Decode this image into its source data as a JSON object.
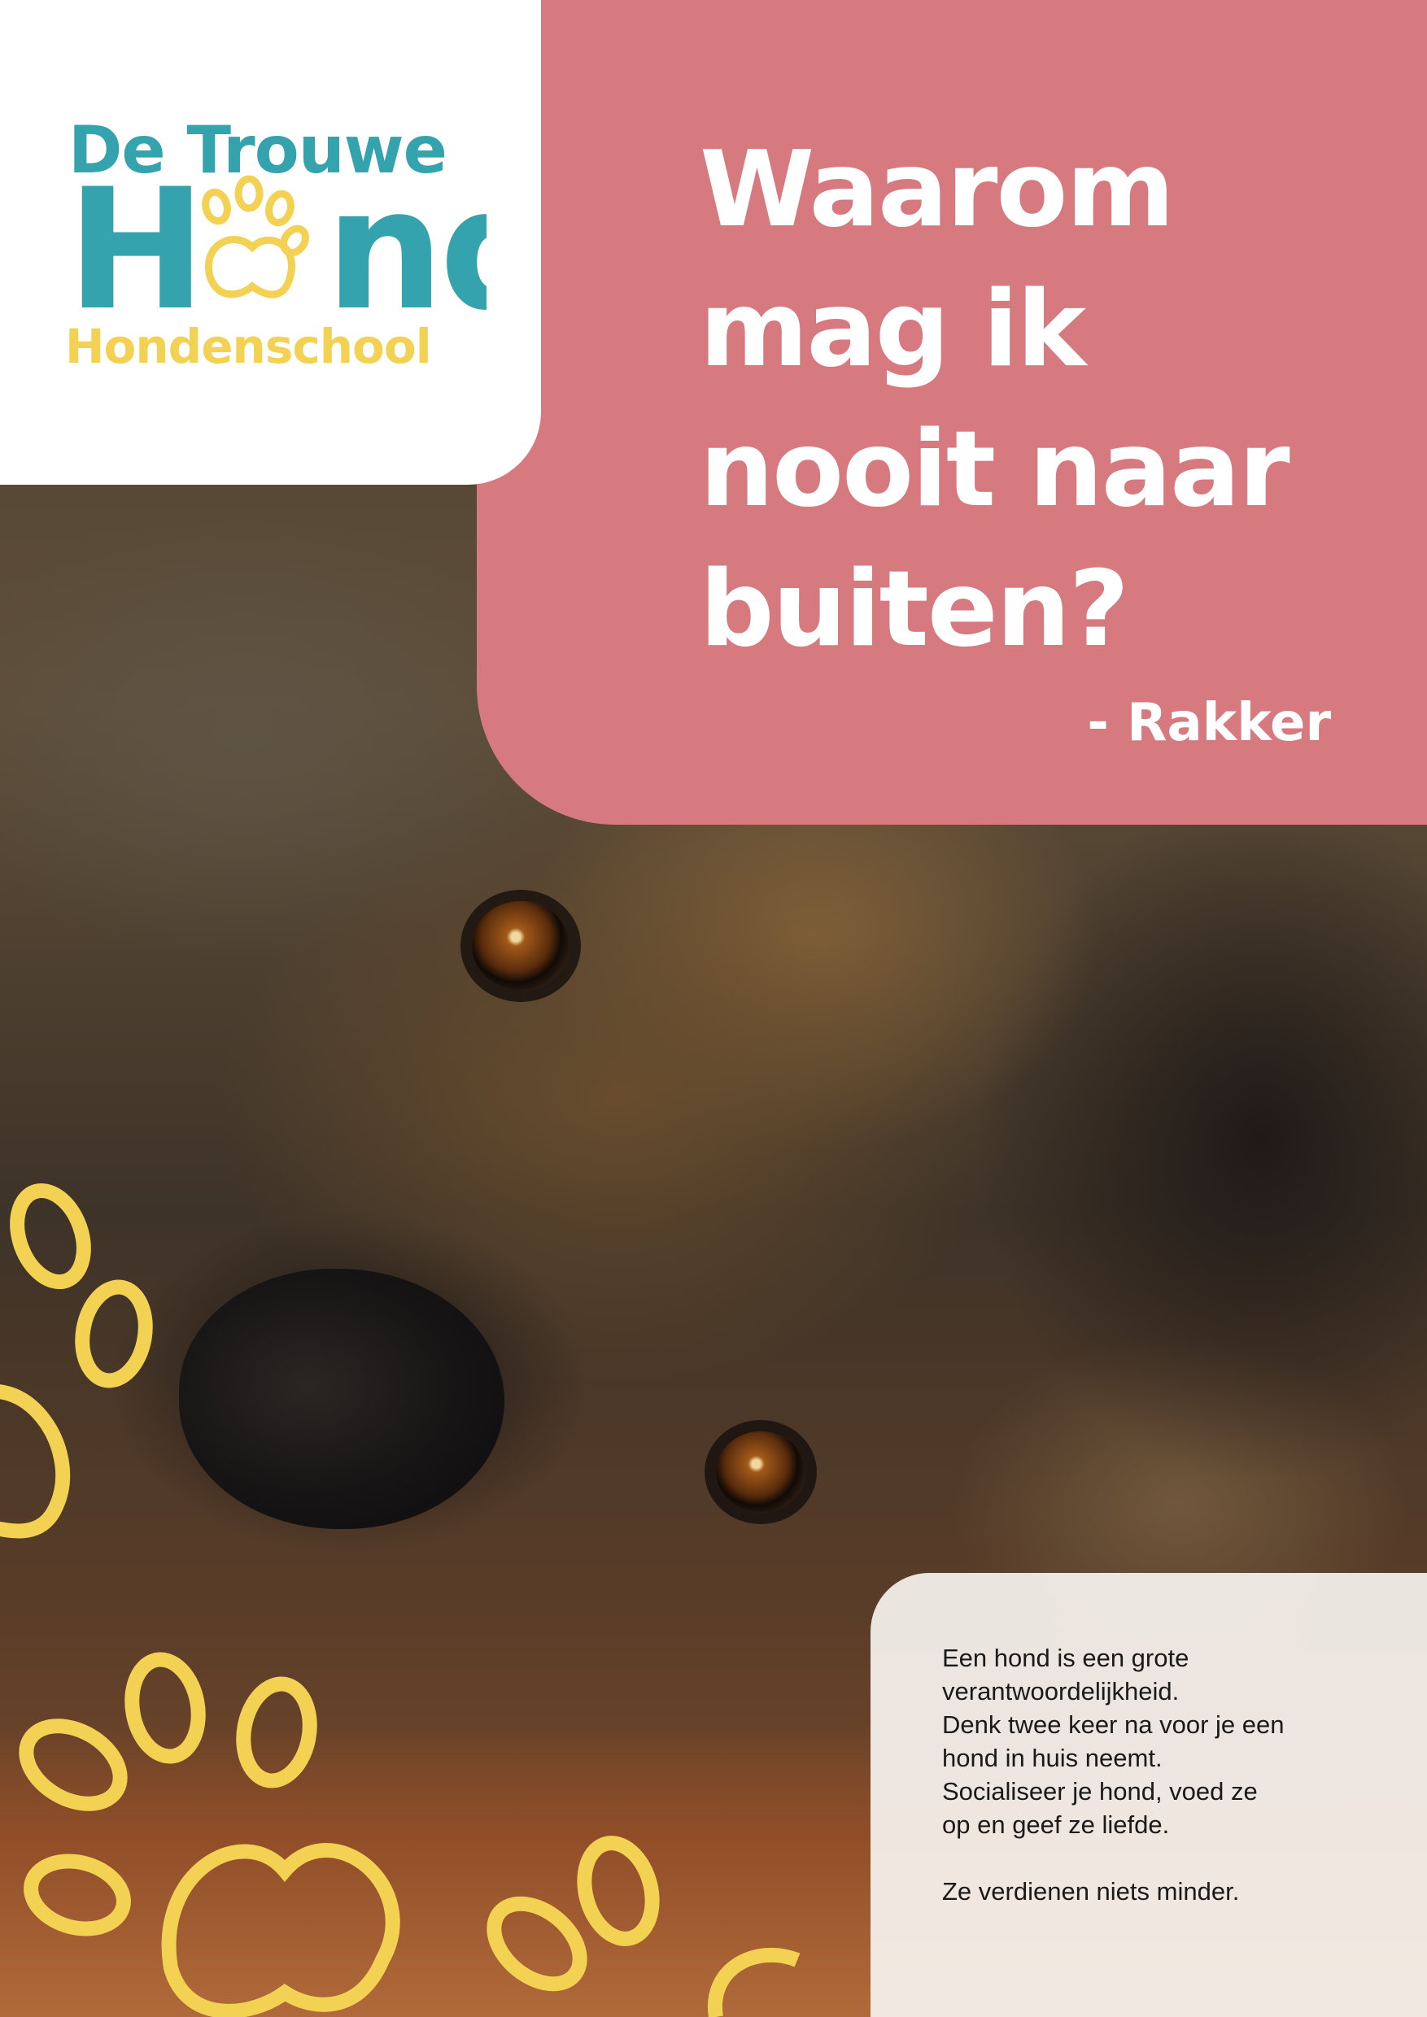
{
  "logo": {
    "line1": "De Trouwe",
    "line2_start": "H",
    "line2_end": "nd",
    "line3": "Hondenschool",
    "colors": {
      "teal": "#35a3ad",
      "yellow": "#f3d153"
    }
  },
  "headline": {
    "lines": [
      "Waarom",
      "mag ik",
      "nooit naar",
      "buiten?"
    ],
    "attribution": "- Rakker",
    "panel_color": "#d67a80"
  },
  "info": {
    "paragraph": [
      "Een hond is een grote",
      "verantwoordelijkheid.",
      "Denk twee keer na voor je een",
      "hond in huis neemt.",
      "Socialiseer je hond, voed ze",
      "op en geef ze liefde."
    ],
    "closing": "Ze verdienen niets minder."
  },
  "decor": {
    "paw_color": "#f3d153",
    "icons": [
      "paw-print-icon"
    ]
  }
}
